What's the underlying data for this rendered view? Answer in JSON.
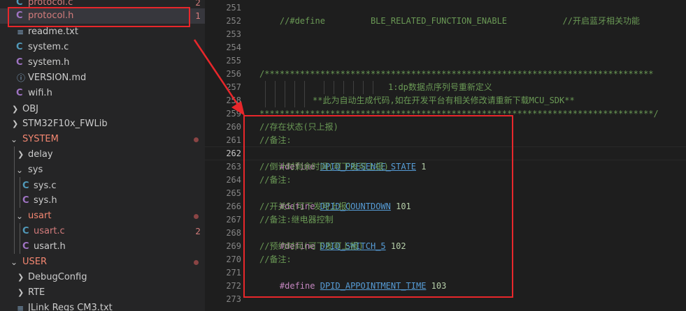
{
  "explorer": {
    "items": [
      {
        "icon": "c-file-icon",
        "label": "protocol.c",
        "badge": "2"
      },
      {
        "icon": "c-header-icon",
        "label": "protocol.h",
        "badge": "1"
      },
      {
        "icon": "text-file-icon",
        "label": "readme.txt",
        "badge": ""
      },
      {
        "icon": "c-file-icon",
        "label": "system.c",
        "badge": ""
      },
      {
        "icon": "c-header-icon",
        "label": "system.h",
        "badge": ""
      },
      {
        "icon": "markdown-file-icon",
        "label": "VERSION.md",
        "badge": ""
      },
      {
        "icon": "c-header-icon",
        "label": "wifi.h",
        "badge": ""
      },
      {
        "icon": "chevron-right-icon",
        "label": "OBJ",
        "badge": ""
      },
      {
        "icon": "chevron-right-icon",
        "label": "STM32F10x_FWLib",
        "badge": ""
      },
      {
        "icon": "chevron-down-icon",
        "label": "SYSTEM",
        "badge": ""
      },
      {
        "icon": "chevron-right-icon",
        "label": "delay",
        "badge": ""
      },
      {
        "icon": "chevron-down-icon",
        "label": "sys",
        "badge": ""
      },
      {
        "icon": "c-file-icon",
        "label": "sys.c",
        "badge": ""
      },
      {
        "icon": "c-header-icon",
        "label": "sys.h",
        "badge": ""
      },
      {
        "icon": "chevron-down-icon",
        "label": "usart",
        "badge": ""
      },
      {
        "icon": "c-file-icon",
        "label": "usart.c",
        "badge": "2"
      },
      {
        "icon": "c-header-icon",
        "label": "usart.h",
        "badge": ""
      },
      {
        "icon": "chevron-down-icon",
        "label": "USER",
        "badge": ""
      },
      {
        "icon": "chevron-right-icon",
        "label": "DebugConfig",
        "badge": ""
      },
      {
        "icon": "chevron-right-icon",
        "label": "RTE",
        "badge": ""
      },
      {
        "icon": "text-file-icon",
        "label": "JLink Regs CM3.txt",
        "badge": ""
      }
    ]
  },
  "editor": {
    "line_numbers": [
      "251",
      "252",
      "253",
      "254",
      "255",
      "256",
      "257",
      "258",
      "259",
      "260",
      "261",
      "262",
      "263",
      "264",
      "265",
      "266",
      "267",
      "268",
      "269",
      "270",
      "271",
      "272",
      "273"
    ],
    "l251_a": "//#define         BLE_RELATED_FUNCTION_ENABLE           //",
    "l251_b": "开启蓝牙相关功能",
    "l256": "/*****************************************************************************",
    "l257": "1:dp数据点序列号重新定义",
    "l258": "**此为自动生成代码,如在开发平台有相关修改请重新下载MCU_SDK**",
    "l259": "******************************************************************************/",
    "l260": "//存在状态(只上报)",
    "l261": "//备注:",
    "l262_kw": "#define",
    "l262_m": "DPID_PRESENCE_STATE",
    "l262_n": "1",
    "l263": "//倒计时剩余时间(可下发可上报)",
    "l264": "//备注:",
    "l265_kw": "#define",
    "l265_m": "DPID_COUNTDOWN",
    "l265_n": "101",
    "l266": "//开关5(可下发可上报)",
    "l267": "//备注:继电器控制",
    "l268_kw": "#define",
    "l268_m": "DPID_SWITCH_5",
    "l268_n": "102",
    "l269": "//预约时间(可下发可上报)",
    "l270": "//备注:",
    "l271_kw": "#define",
    "l271_m": "DPID_APPOINTMENT_TIME",
    "l271_n": "103"
  },
  "colors": {
    "annotation_red": "#e8272b",
    "error_badge": "#d47c7c",
    "folder_error": "#f48771"
  }
}
